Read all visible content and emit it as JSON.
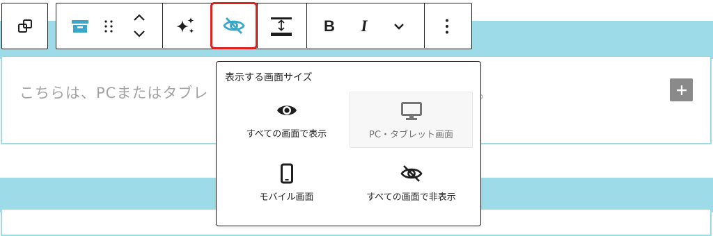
{
  "editor": {
    "paragraph_placeholder": "こちらは、PCまたはタブレ",
    "paragraph_placeholder_tail": "。",
    "add_block_label": "+"
  },
  "toolbar": {
    "bold_label": "B",
    "italic_label": "I",
    "accent_color": "#3aa7c9",
    "highlight_color": "#e0201d",
    "icons": [
      "duplicate-icon",
      "block-type-icon",
      "drag-handle-icon",
      "move-up-icon",
      "move-down-icon",
      "ai-sparkle-icon",
      "visibility-hidden-icon",
      "vertical-spacing-icon",
      "bold",
      "italic",
      "more-formats-chevron-icon",
      "options-kebab-icon"
    ]
  },
  "visibility_popover": {
    "title": "表示する画面サイズ",
    "selected": "PC・タブレット画面",
    "options": [
      {
        "label": "すべての画面で表示",
        "icon": "eye-icon"
      },
      {
        "label": "PC・タブレット画面",
        "icon": "desktop-monitor-icon"
      },
      {
        "label": "モバイル画面",
        "icon": "mobile-phone-icon"
      },
      {
        "label": "すべての画面で非表示",
        "icon": "eye-slash-icon"
      }
    ]
  }
}
